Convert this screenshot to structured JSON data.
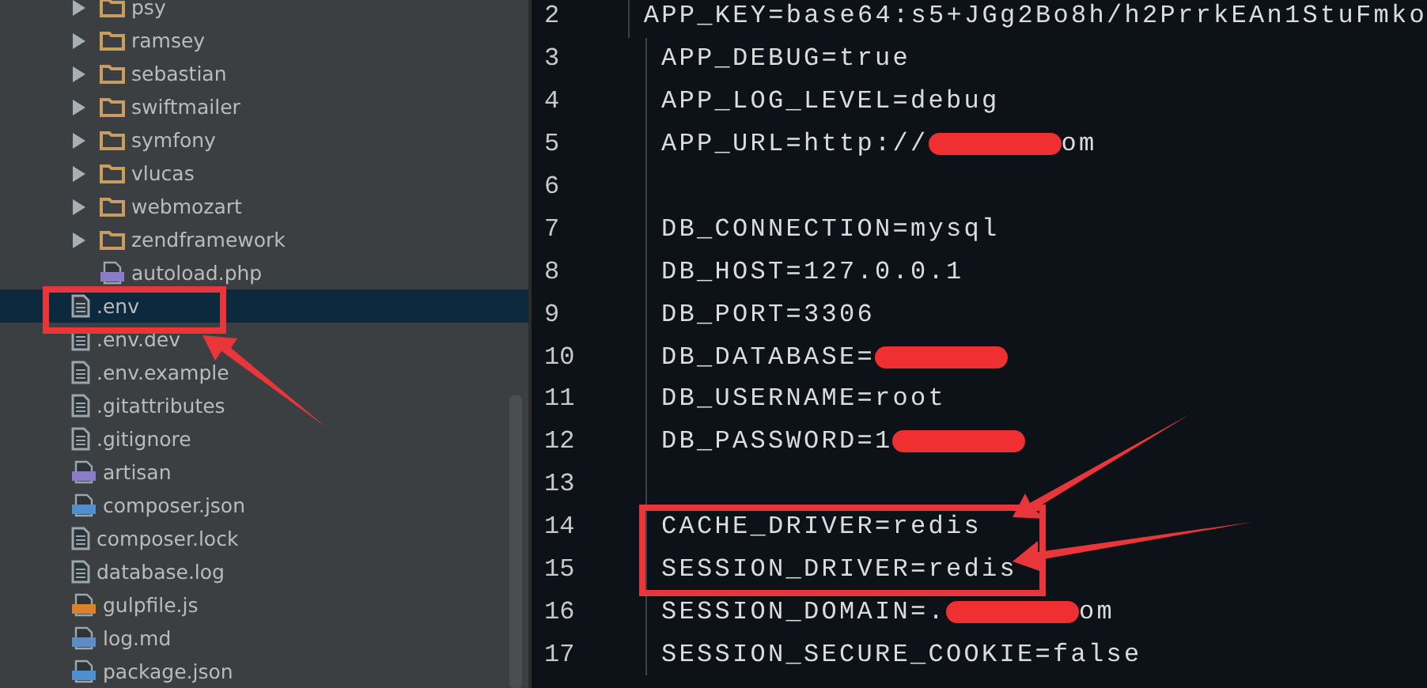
{
  "project_tree": [
    {
      "children": [
        {
          "label": "psy",
          "kind": "folder",
          "expanded": false
        },
        {
          "label": "ramsey",
          "kind": "folder",
          "expanded": false
        },
        {
          "label": "sebastian",
          "kind": "folder",
          "expanded": false
        },
        {
          "label": "swiftmailer",
          "kind": "folder",
          "expanded": false
        },
        {
          "label": "symfony",
          "kind": "folder",
          "expanded": false
        },
        {
          "label": "vlucas",
          "kind": "folder",
          "expanded": false
        },
        {
          "label": "webmozart",
          "kind": "folder",
          "expanded": false
        },
        {
          "label": "zendframework",
          "kind": "folder",
          "expanded": false
        },
        {
          "label": "autoload.php",
          "kind": "php",
          "selected": false
        }
      ]
    },
    {
      "label": ".env",
      "kind": "text",
      "selected": true
    },
    {
      "label": ".env.dev",
      "kind": "text",
      "selected": false
    },
    {
      "label": ".env.example",
      "kind": "text",
      "selected": false
    },
    {
      "label": ".gitattributes",
      "kind": "text",
      "selected": false
    },
    {
      "label": ".gitignore",
      "kind": "text",
      "selected": false
    },
    {
      "label": "artisan",
      "kind": "php",
      "selected": false
    },
    {
      "label": "composer.json",
      "kind": "json",
      "selected": false
    },
    {
      "label": "composer.lock",
      "kind": "text",
      "selected": false
    },
    {
      "label": "database.log",
      "kind": "text",
      "selected": false
    },
    {
      "label": "gulpfile.js",
      "kind": "js",
      "selected": false
    },
    {
      "label": "log.md",
      "kind": "md",
      "selected": false
    },
    {
      "label": "package.json",
      "kind": "json",
      "selected": false
    }
  ],
  "editor": {
    "lines": [
      {
        "number": "2",
        "text": "APP_KEY=base64:s5+JGg2Bo8h/h2PrrkEAn1StuFmko"
      },
      {
        "number": "3",
        "text": "APP_DEBUG=true"
      },
      {
        "number": "4",
        "text": "APP_LOG_LEVEL=debug"
      },
      {
        "number": "5",
        "text": "APP_URL=http://",
        "redacted": true,
        "after": "om"
      },
      {
        "number": "6"
      },
      {
        "number": "7",
        "text": "DB_CONNECTION=mysql"
      },
      {
        "number": "8",
        "text": "DB_HOST=127.0.0.1"
      },
      {
        "number": "9",
        "text": "DB_PORT=3306"
      },
      {
        "number": "10",
        "text": "DB_DATABASE=",
        "redacted": true
      },
      {
        "number": "11",
        "text": "DB_USERNAME=root"
      },
      {
        "number": "12",
        "text": "DB_PASSWORD=1",
        "redacted": true
      },
      {
        "number": "13"
      },
      {
        "number": "14",
        "text": "CACHE_DRIVER=redis"
      },
      {
        "number": "15",
        "text": "SESSION_DRIVER=redis"
      },
      {
        "number": "16",
        "text": "SESSION_DOMAIN=.",
        "redacted": true,
        "after": "om"
      },
      {
        "number": "17",
        "text": "SESSION_SECURE_COOKIE=false"
      }
    ]
  }
}
